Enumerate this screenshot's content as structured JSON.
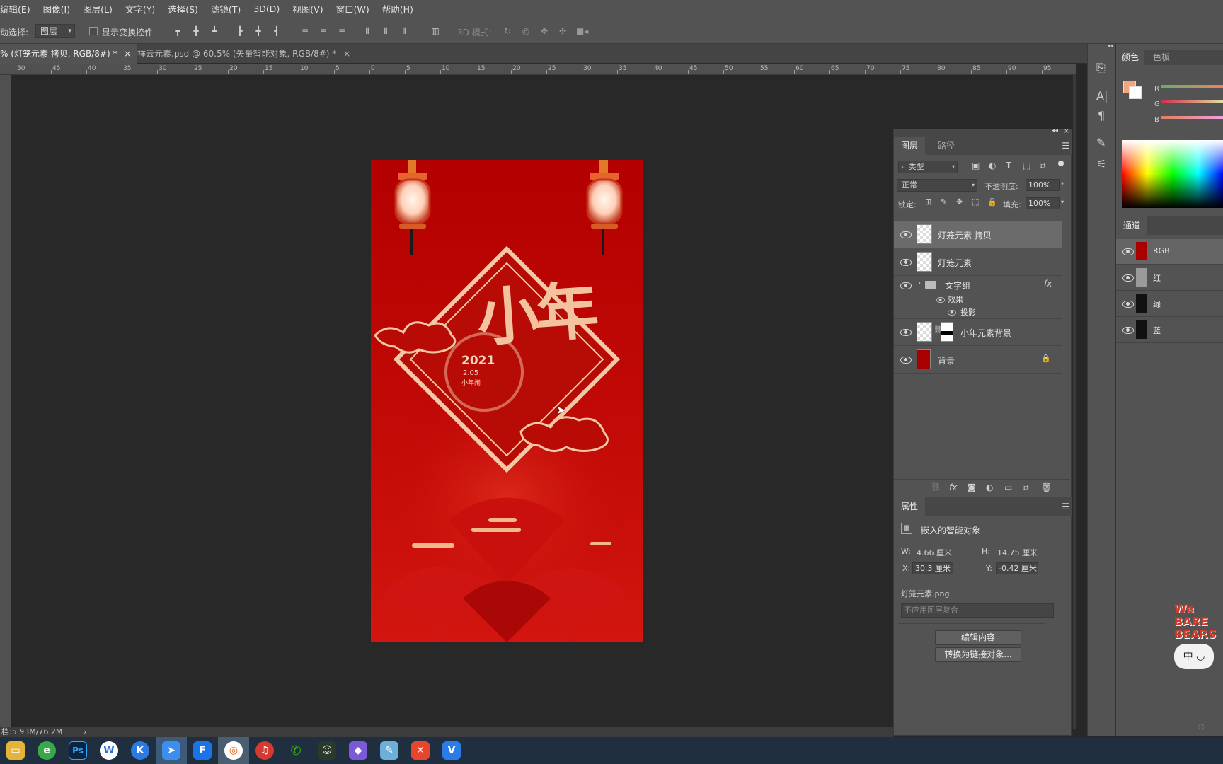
{
  "menu": [
    "编辑(E)",
    "图像(I)",
    "图层(L)",
    "文字(Y)",
    "选择(S)",
    "滤镜(T)",
    "3D(D)",
    "视图(V)",
    "窗口(W)",
    "帮助(H)"
  ],
  "options": {
    "auto_select_label": "动选择:",
    "auto_select_value": "图层",
    "show_transform": "显示变换控件",
    "mode_3d": "3D 模式:"
  },
  "tabs": [
    {
      "label": "% (灯笼元素 拷贝, RGB/8#) *",
      "close": "×"
    },
    {
      "label": "祥云元素.psd @ 60.5% (矢量智能对象, RGB/8#) *",
      "close": "×"
    }
  ],
  "ruler_ticks": [
    "50",
    "45",
    "40",
    "35",
    "30",
    "25",
    "20",
    "15",
    "10",
    "5",
    "0",
    "5",
    "10",
    "15",
    "20",
    "25",
    "30",
    "35",
    "40",
    "45",
    "50",
    "55",
    "60",
    "65",
    "70",
    "75",
    "80",
    "85",
    "90",
    "95"
  ],
  "artwork": {
    "big_text": "小年",
    "year": "2021",
    "date": "2.05",
    "caption": "小年闹"
  },
  "layers_panel": {
    "tabs": [
      "图层",
      "路径"
    ],
    "filter": "类型",
    "blend": "正常",
    "opacity_label": "不透明度:",
    "opacity": "100%",
    "lock_label": "锁定:",
    "fill_label": "填充:",
    "fill": "100%",
    "layers": [
      {
        "name": "灯笼元素 拷贝",
        "selected": true
      },
      {
        "name": "灯笼元素",
        "selected": false
      },
      {
        "name": "文字组",
        "group": true,
        "fx": "fx"
      },
      {
        "name": "效果",
        "sub": true
      },
      {
        "name": "投影",
        "sub2": true
      },
      {
        "name": "小年元素背景",
        "mask": true
      },
      {
        "name": "背景",
        "locked": true
      }
    ]
  },
  "properties": {
    "title": "属性",
    "type": "嵌入的智能对象",
    "w_label": "W:",
    "w": "4.66 厘米",
    "h_label": "H:",
    "h": "14.75 厘米",
    "x_label": "X:",
    "x": "30.3 厘米",
    "y_label": "Y:",
    "y": "-0.42 厘米",
    "file": "灯笼元素.png",
    "comp_placeholder": "不应用图层复合",
    "edit_btn": "编辑内容",
    "convert_btn": "转换为链接对象..."
  },
  "color_panel": {
    "tabs": [
      "颜色",
      "色板"
    ],
    "labels": [
      "R",
      "G",
      "B"
    ]
  },
  "channels": {
    "title": "通道",
    "items": [
      "RGB",
      "红",
      "绿",
      "蓝"
    ]
  },
  "status": "档:5.93M/76.2M",
  "watermark": "We BARE BEARS",
  "colors": {
    "accent": "#b30000",
    "fg_swatch": "#f2a47a"
  }
}
